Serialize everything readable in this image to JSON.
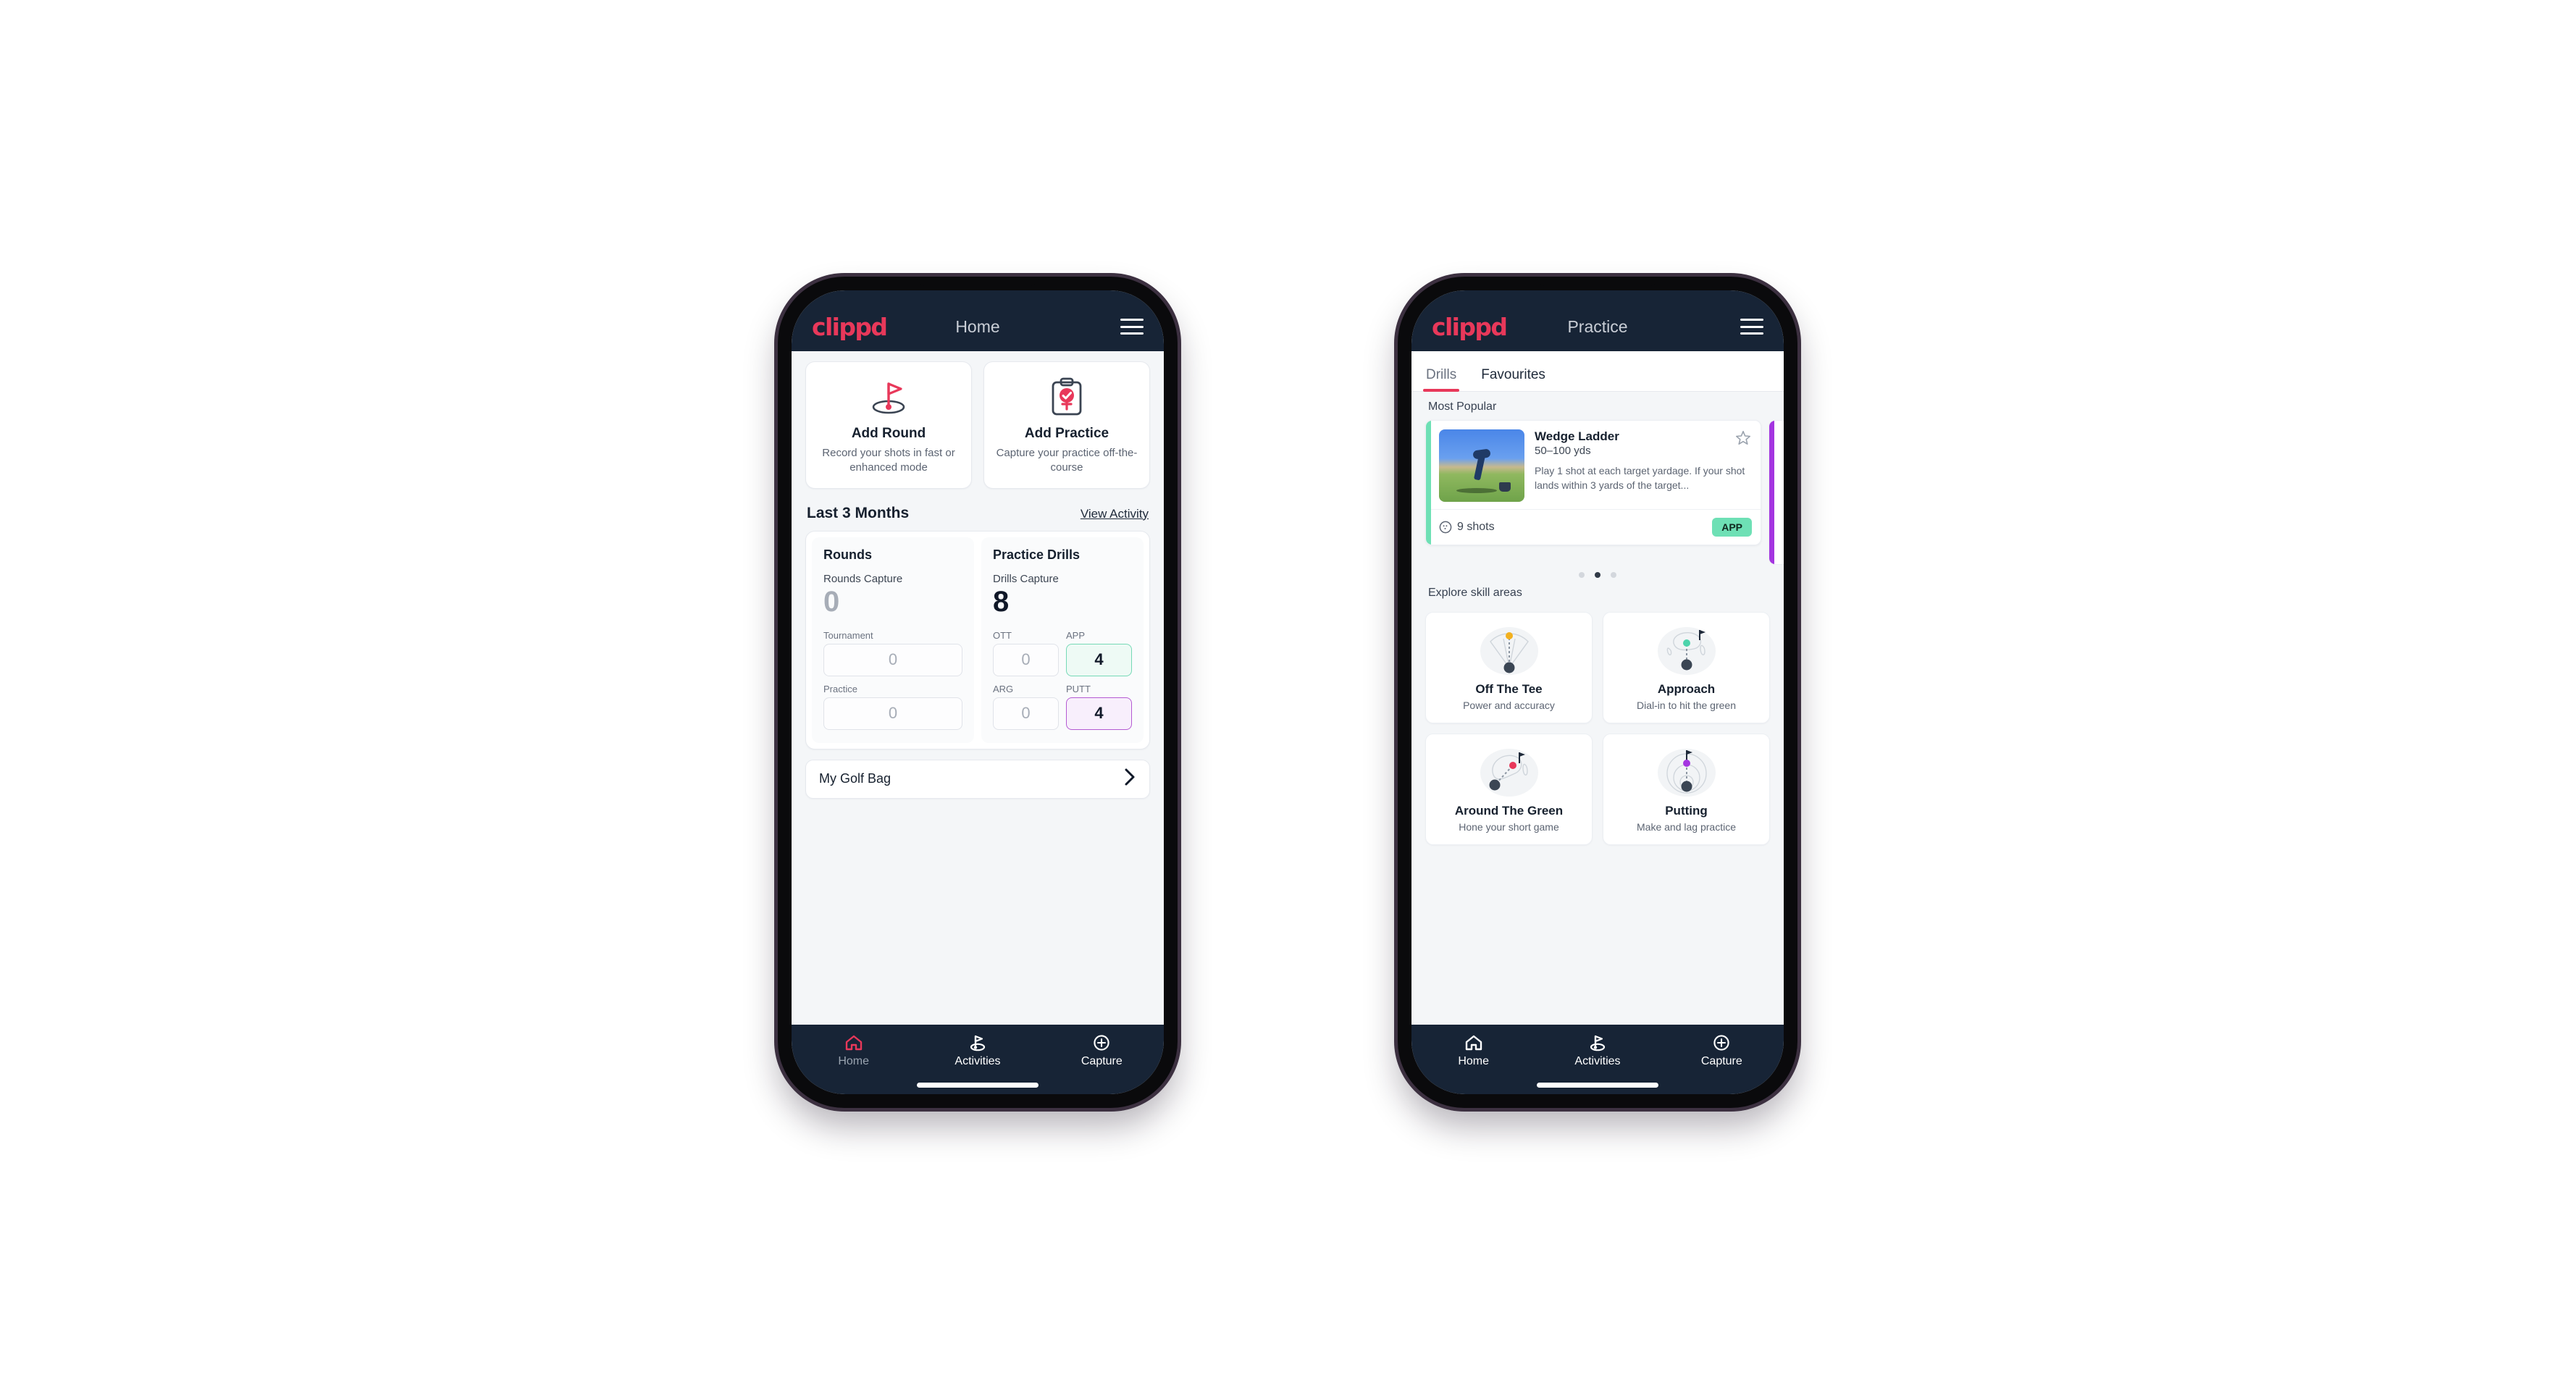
{
  "brand": {
    "logo_text": "clippd",
    "accent": "#e8385a",
    "appbar_bg": "#172436"
  },
  "phone_home": {
    "appbar": {
      "title": "Home",
      "menu_icon": "hamburger-icon"
    },
    "actions": [
      {
        "icon": "golf-flag-hole-icon",
        "title": "Add Round",
        "subtitle": "Record your shots in fast or enhanced mode"
      },
      {
        "icon": "clipboard-check-icon",
        "title": "Add Practice",
        "subtitle": "Capture your practice off-the-course"
      }
    ],
    "section": {
      "title": "Last 3 Months",
      "link": "View Activity"
    },
    "rounds": {
      "heading": "Rounds",
      "capture_label": "Rounds Capture",
      "capture_value": "0",
      "fields": [
        {
          "label": "Tournament",
          "value": "0",
          "state": "empty"
        },
        {
          "label": "Practice",
          "value": "0",
          "state": "empty"
        }
      ]
    },
    "drills": {
      "heading": "Practice Drills",
      "capture_label": "Drills Capture",
      "capture_value": "8",
      "fields": [
        {
          "label": "OTT",
          "value": "0",
          "state": "empty"
        },
        {
          "label": "APP",
          "value": "4",
          "state": "app",
          "color": "#76d9b6"
        },
        {
          "label": "ARG",
          "value": "0",
          "state": "empty"
        },
        {
          "label": "PUTT",
          "value": "4",
          "state": "putt",
          "color": "#b45ad2"
        }
      ]
    },
    "golf_bag": {
      "label": "My Golf Bag",
      "chevron": "chevron-right-icon"
    },
    "bottom_nav": [
      {
        "icon": "home-icon",
        "label": "Home",
        "active": true
      },
      {
        "icon": "golf-flag-icon",
        "label": "Activities",
        "active": false
      },
      {
        "icon": "plus-circle-icon",
        "label": "Capture",
        "active": false
      }
    ]
  },
  "phone_practice": {
    "appbar": {
      "title": "Practice",
      "menu_icon": "hamburger-icon"
    },
    "tabs": [
      {
        "label": "Drills",
        "active": true
      },
      {
        "label": "Favourites",
        "active": false
      }
    ],
    "most_popular_label": "Most Popular",
    "drill": {
      "title": "Wedge Ladder",
      "yardage": "50–100 yds",
      "description": "Play 1 shot at each target yardage. If your shot lands within 3 yards of the target...",
      "shots": "9 shots",
      "shots_icon": "golf-ball-icon",
      "badge": "APP",
      "badge_color": "#6ee0b5",
      "accent_color": "#6ee0b5",
      "favourite_icon": "star-outline-icon",
      "thumbnail": "golfer-wedge-photo"
    },
    "next_drill_accent": "#a435e0",
    "carousel_dots": {
      "count": 3,
      "active_index": 1
    },
    "explore_label": "Explore skill areas",
    "skills": [
      {
        "icon": "tee-shot-fan-icon",
        "title": "Off The Tee",
        "subtitle": "Power and accuracy",
        "dot_color": "#f2b01e"
      },
      {
        "icon": "approach-green-icon",
        "title": "Approach",
        "subtitle": "Dial-in to hit the green",
        "dot_color": "#4dd4ac"
      },
      {
        "icon": "around-green-icon",
        "title": "Around The Green",
        "subtitle": "Hone your short game",
        "dot_color": "#e8385a"
      },
      {
        "icon": "putting-rings-icon",
        "title": "Putting",
        "subtitle": "Make and lag practice",
        "dot_color": "#a435e0"
      }
    ],
    "bottom_nav": [
      {
        "icon": "home-icon",
        "label": "Home",
        "active": false
      },
      {
        "icon": "golf-flag-icon",
        "label": "Activities",
        "active": false
      },
      {
        "icon": "plus-circle-icon",
        "label": "Capture",
        "active": false
      }
    ]
  }
}
